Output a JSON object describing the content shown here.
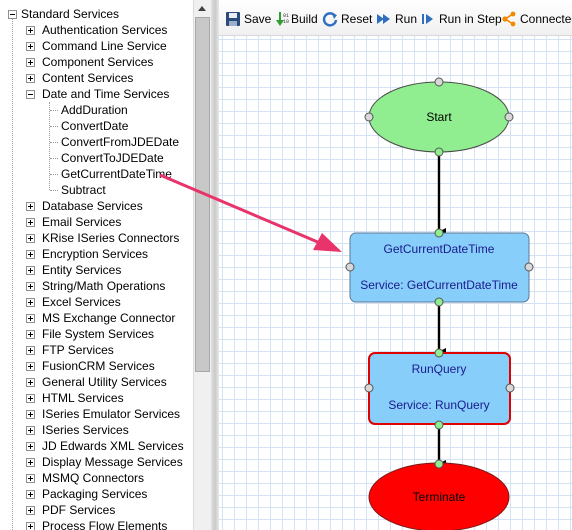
{
  "tree": {
    "root": "Standard Services",
    "items": [
      {
        "label": "Authentication Services",
        "state": "collapsed"
      },
      {
        "label": "Command Line Service",
        "state": "collapsed"
      },
      {
        "label": "Component Services",
        "state": "collapsed"
      },
      {
        "label": "Content Services",
        "state": "collapsed"
      },
      {
        "label": "Date and Time Services",
        "state": "expanded",
        "children": [
          "AddDuration",
          "ConvertDate",
          "ConvertFromJDEDate",
          "ConvertToJDEDate",
          "GetCurrentDateTime",
          "Subtract"
        ]
      },
      {
        "label": "Database Services",
        "state": "collapsed"
      },
      {
        "label": "Email Services",
        "state": "collapsed"
      },
      {
        "label": "KRise ISeries Connectors",
        "state": "collapsed"
      },
      {
        "label": "Encryption Services",
        "state": "collapsed"
      },
      {
        "label": "Entity Services",
        "state": "collapsed"
      },
      {
        "label": "String/Math Operations",
        "state": "collapsed"
      },
      {
        "label": "Excel Services",
        "state": "collapsed"
      },
      {
        "label": "MS Exchange Connector",
        "state": "collapsed"
      },
      {
        "label": "File System Services",
        "state": "collapsed"
      },
      {
        "label": "FTP Services",
        "state": "collapsed"
      },
      {
        "label": "FusionCRM Services",
        "state": "collapsed"
      },
      {
        "label": "General Utility Services",
        "state": "collapsed"
      },
      {
        "label": "HTML Services",
        "state": "collapsed"
      },
      {
        "label": "ISeries Emulator Services",
        "state": "collapsed"
      },
      {
        "label": "ISeries Services",
        "state": "collapsed"
      },
      {
        "label": "JD Edwards XML Services",
        "state": "collapsed"
      },
      {
        "label": "Display Message Services",
        "state": "collapsed"
      },
      {
        "label": "MSMQ Connectors",
        "state": "collapsed"
      },
      {
        "label": "Packaging Services",
        "state": "collapsed"
      },
      {
        "label": "PDF Services",
        "state": "collapsed"
      },
      {
        "label": "Process Flow Elements",
        "state": "collapsed"
      }
    ]
  },
  "toolbar": {
    "save": "Save",
    "build": "Build",
    "reset": "Reset",
    "run": "Run",
    "run_in_step": "Run in Step",
    "connected": "Connected"
  },
  "flow": {
    "start": "Start",
    "get_current": {
      "title": "GetCurrentDateTime",
      "service": "Service: GetCurrentDateTime"
    },
    "run_query": {
      "title": "RunQuery",
      "service": "Service: RunQuery"
    },
    "terminate": "Terminate"
  },
  "colors": {
    "start_fill": "#90ee90",
    "service_fill": "#87cefa",
    "terminate_fill": "#ff0000",
    "selected_border": "#e00000",
    "arrow_annotation": "#e8336b",
    "service_text": "#1a1a8c"
  }
}
